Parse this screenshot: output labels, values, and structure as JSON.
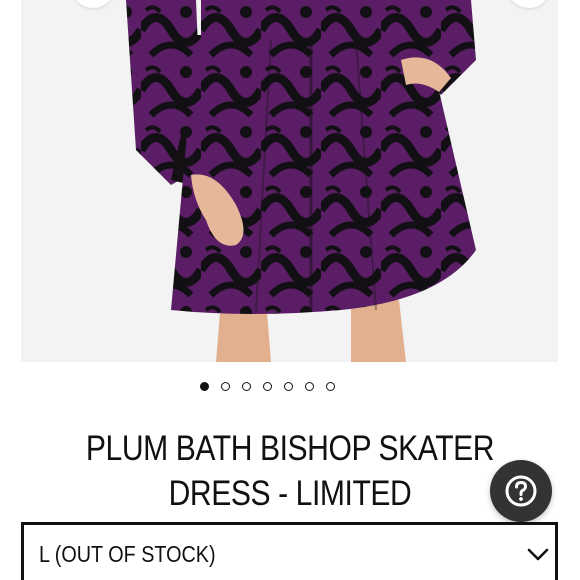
{
  "product": {
    "title": "PLUM BATH BISHOP SKATER DRESS - LIMITED",
    "image": {
      "description_icon": "product-photo",
      "dress_color": "#5b1e66",
      "pattern_color": "#121014",
      "skin_color": "#e6b89a"
    }
  },
  "carousel": {
    "dot_count": 7,
    "active_index": 0
  },
  "size_select": {
    "selected_value": "L (OUT OF STOCK)",
    "icon": "chevron-down-icon"
  },
  "help": {
    "icon": "question-mark-icon",
    "glyph": "?"
  },
  "colors": {
    "text": "#111111",
    "help_bg": "#333333"
  }
}
